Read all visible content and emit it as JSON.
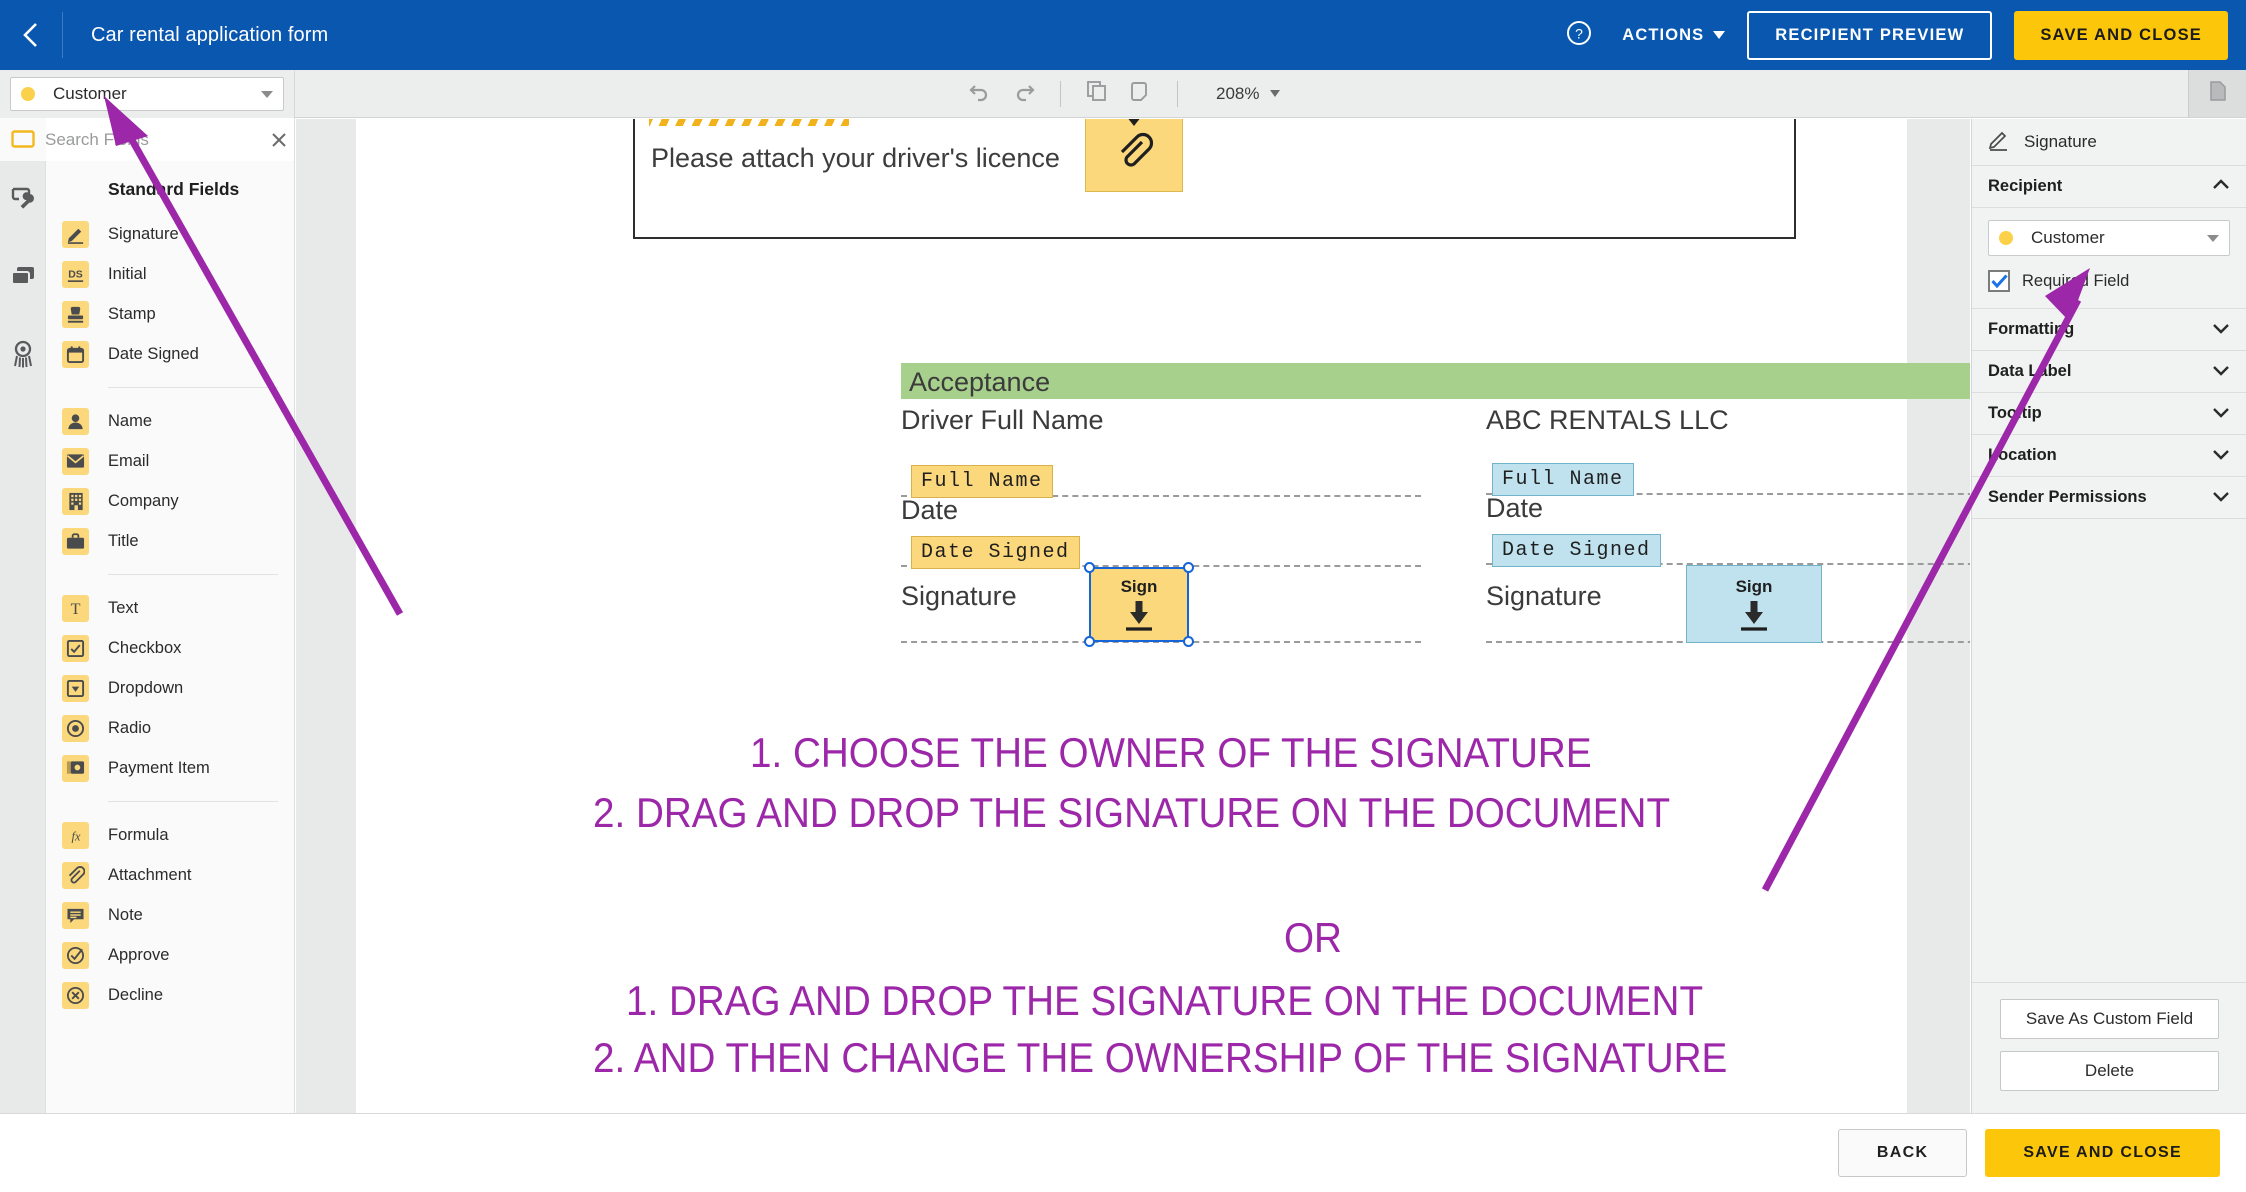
{
  "header": {
    "back_icon": "chevron-left-icon",
    "title": "Car rental application form",
    "help_icon": "help-circle-icon",
    "actions_label": "ACTIONS",
    "recipient_preview_label": "RECIPIENT PREVIEW",
    "save_and_close_label": "SAVE AND CLOSE",
    "accent_blue": "#0a57b0",
    "accent_yellow": "#fcc60a"
  },
  "toolbar": {
    "undo_icon": "undo-icon",
    "redo_icon": "redo-icon",
    "copy_icon": "copy-icon",
    "paste_icon": "paste-icon",
    "zoom_level": "208%",
    "pages_icon": "pages-panel-icon"
  },
  "recipient_selector": {
    "name": "Customer",
    "dot_color": "#fbd14b"
  },
  "search": {
    "icon": "search-icon",
    "placeholder": "Search Fields",
    "value": "",
    "clear_icon": "close-icon"
  },
  "rail": {
    "items": [
      {
        "icon": "field-rectangle-icon",
        "name": "fields"
      },
      {
        "icon": "tools-wrench-icon",
        "name": "tools"
      },
      {
        "icon": "layers-icon",
        "name": "layers"
      },
      {
        "icon": "seal-badge-icon",
        "name": "certificate"
      }
    ]
  },
  "fields_panel": {
    "section_title": "Standard Fields",
    "groups": [
      {
        "items": [
          {
            "label": "Signature",
            "icon": "pen-signature-icon"
          },
          {
            "label": "Initial",
            "icon": "initial-ds-icon"
          },
          {
            "label": "Stamp",
            "icon": "stamp-icon"
          },
          {
            "label": "Date Signed",
            "icon": "calendar-icon"
          }
        ]
      },
      {
        "items": [
          {
            "label": "Name",
            "icon": "person-icon"
          },
          {
            "label": "Email",
            "icon": "envelope-icon"
          },
          {
            "label": "Company",
            "icon": "building-icon"
          },
          {
            "label": "Title",
            "icon": "briefcase-icon"
          }
        ]
      },
      {
        "items": [
          {
            "label": "Text",
            "icon": "text-t-icon"
          },
          {
            "label": "Checkbox",
            "icon": "checkbox-icon"
          },
          {
            "label": "Dropdown",
            "icon": "dropdown-icon"
          },
          {
            "label": "Radio",
            "icon": "radio-icon"
          },
          {
            "label": "Payment Item",
            "icon": "payment-icon"
          }
        ]
      },
      {
        "items": [
          {
            "label": "Formula",
            "icon": "formula-fx-icon"
          },
          {
            "label": "Attachment",
            "icon": "paperclip-icon"
          },
          {
            "label": "Note",
            "icon": "note-icon"
          },
          {
            "label": "Approve",
            "icon": "approve-check-icon"
          },
          {
            "label": "Decline",
            "icon": "decline-x-icon"
          }
        ]
      }
    ]
  },
  "document": {
    "attachment_prompt": "Please attach your driver's licence",
    "attachment_field_label": "attachment-field",
    "acceptance_band": "Acceptance",
    "left_column": {
      "heading": "Driver Full Name",
      "date_label": "Date",
      "signature_label": "Signature",
      "full_name_tag": "Full Name",
      "date_signed_tag": "Date Signed",
      "sign_label": "Sign",
      "color": "#fcd87c"
    },
    "right_column": {
      "heading": "ABC RENTALS LLC",
      "date_label": "Date",
      "signature_label": "Signature",
      "full_name_tag": "Full Name",
      "date_signed_tag": "Date Signed",
      "sign_label": "Sign",
      "color": "#bfe2ee"
    },
    "annotations": {
      "color": "#9c27a8",
      "lines": [
        "1. CHOOSE THE OWNER OF THE SIGNATURE",
        "2. DRAG AND DROP THE SIGNATURE ON THE DOCUMENT",
        "OR",
        "1. DRAG AND DROP THE SIGNATURE ON THE DOCUMENT",
        "2. AND THEN CHANGE THE OWNERSHIP OF THE SIGNATURE"
      ]
    }
  },
  "properties_panel": {
    "field_type": "Signature",
    "field_type_icon": "pen-signature-icon",
    "sections": [
      {
        "label": "Recipient",
        "expanded": true
      },
      {
        "label": "Formatting",
        "expanded": false
      },
      {
        "label": "Data Label",
        "expanded": false
      },
      {
        "label": "Tooltip",
        "expanded": false
      },
      {
        "label": "Location",
        "expanded": false
      },
      {
        "label": "Sender Permissions",
        "expanded": false
      }
    ],
    "recipient_value": "Customer",
    "required_field_label": "Required Field",
    "required_field_checked": true,
    "save_custom_label": "Save As Custom Field",
    "delete_label": "Delete"
  },
  "footer": {
    "back_label": "BACK",
    "save_and_close_label": "SAVE AND CLOSE"
  }
}
